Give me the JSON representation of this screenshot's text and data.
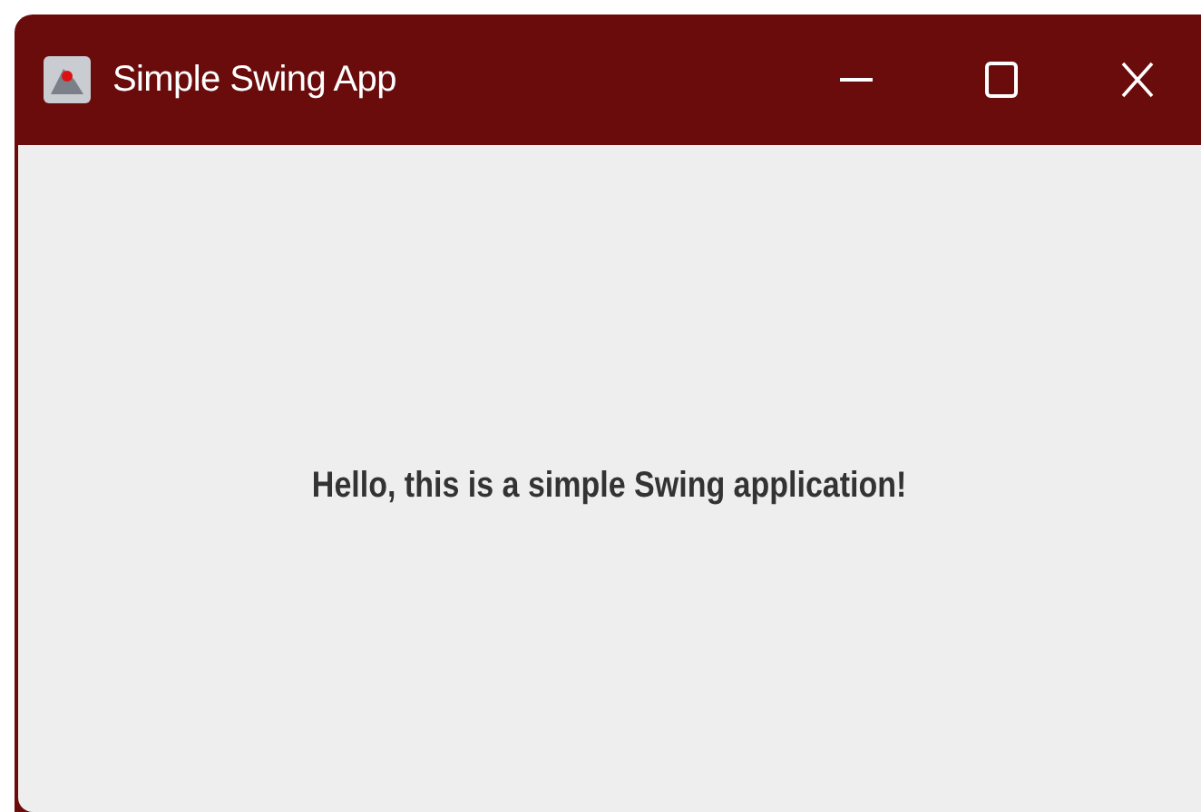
{
  "window": {
    "title": "Simple Swing App"
  },
  "content": {
    "label": "Hello, this is a simple Swing application!"
  }
}
